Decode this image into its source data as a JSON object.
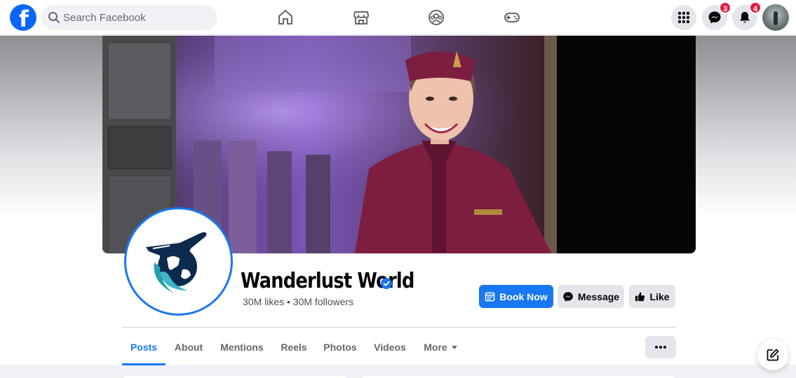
{
  "topbar": {
    "logo_letter": "f",
    "search_placeholder": "Search Facebook",
    "nav_icons": [
      "home-icon",
      "marketplace-icon",
      "groups-icon",
      "gaming-icon"
    ],
    "menu_icon": "grid-menu-icon",
    "messenger_badge": "3",
    "notifications_badge": "4"
  },
  "profile": {
    "name": "Wanderlust World",
    "stats": "30M likes • 30M followers",
    "verified": true
  },
  "actions": {
    "book_now": "Book Now",
    "message": "Message",
    "like": "Like"
  },
  "tabs": [
    {
      "label": "Posts",
      "active": true
    },
    {
      "label": "About"
    },
    {
      "label": "Mentions"
    },
    {
      "label": "Reels"
    },
    {
      "label": "Photos"
    },
    {
      "label": "Videos"
    },
    {
      "label": "More"
    }
  ],
  "colors": {
    "accent": "#1877f2",
    "badge": "#e41e3f",
    "cover_uniform": "#7d1d3f"
  }
}
